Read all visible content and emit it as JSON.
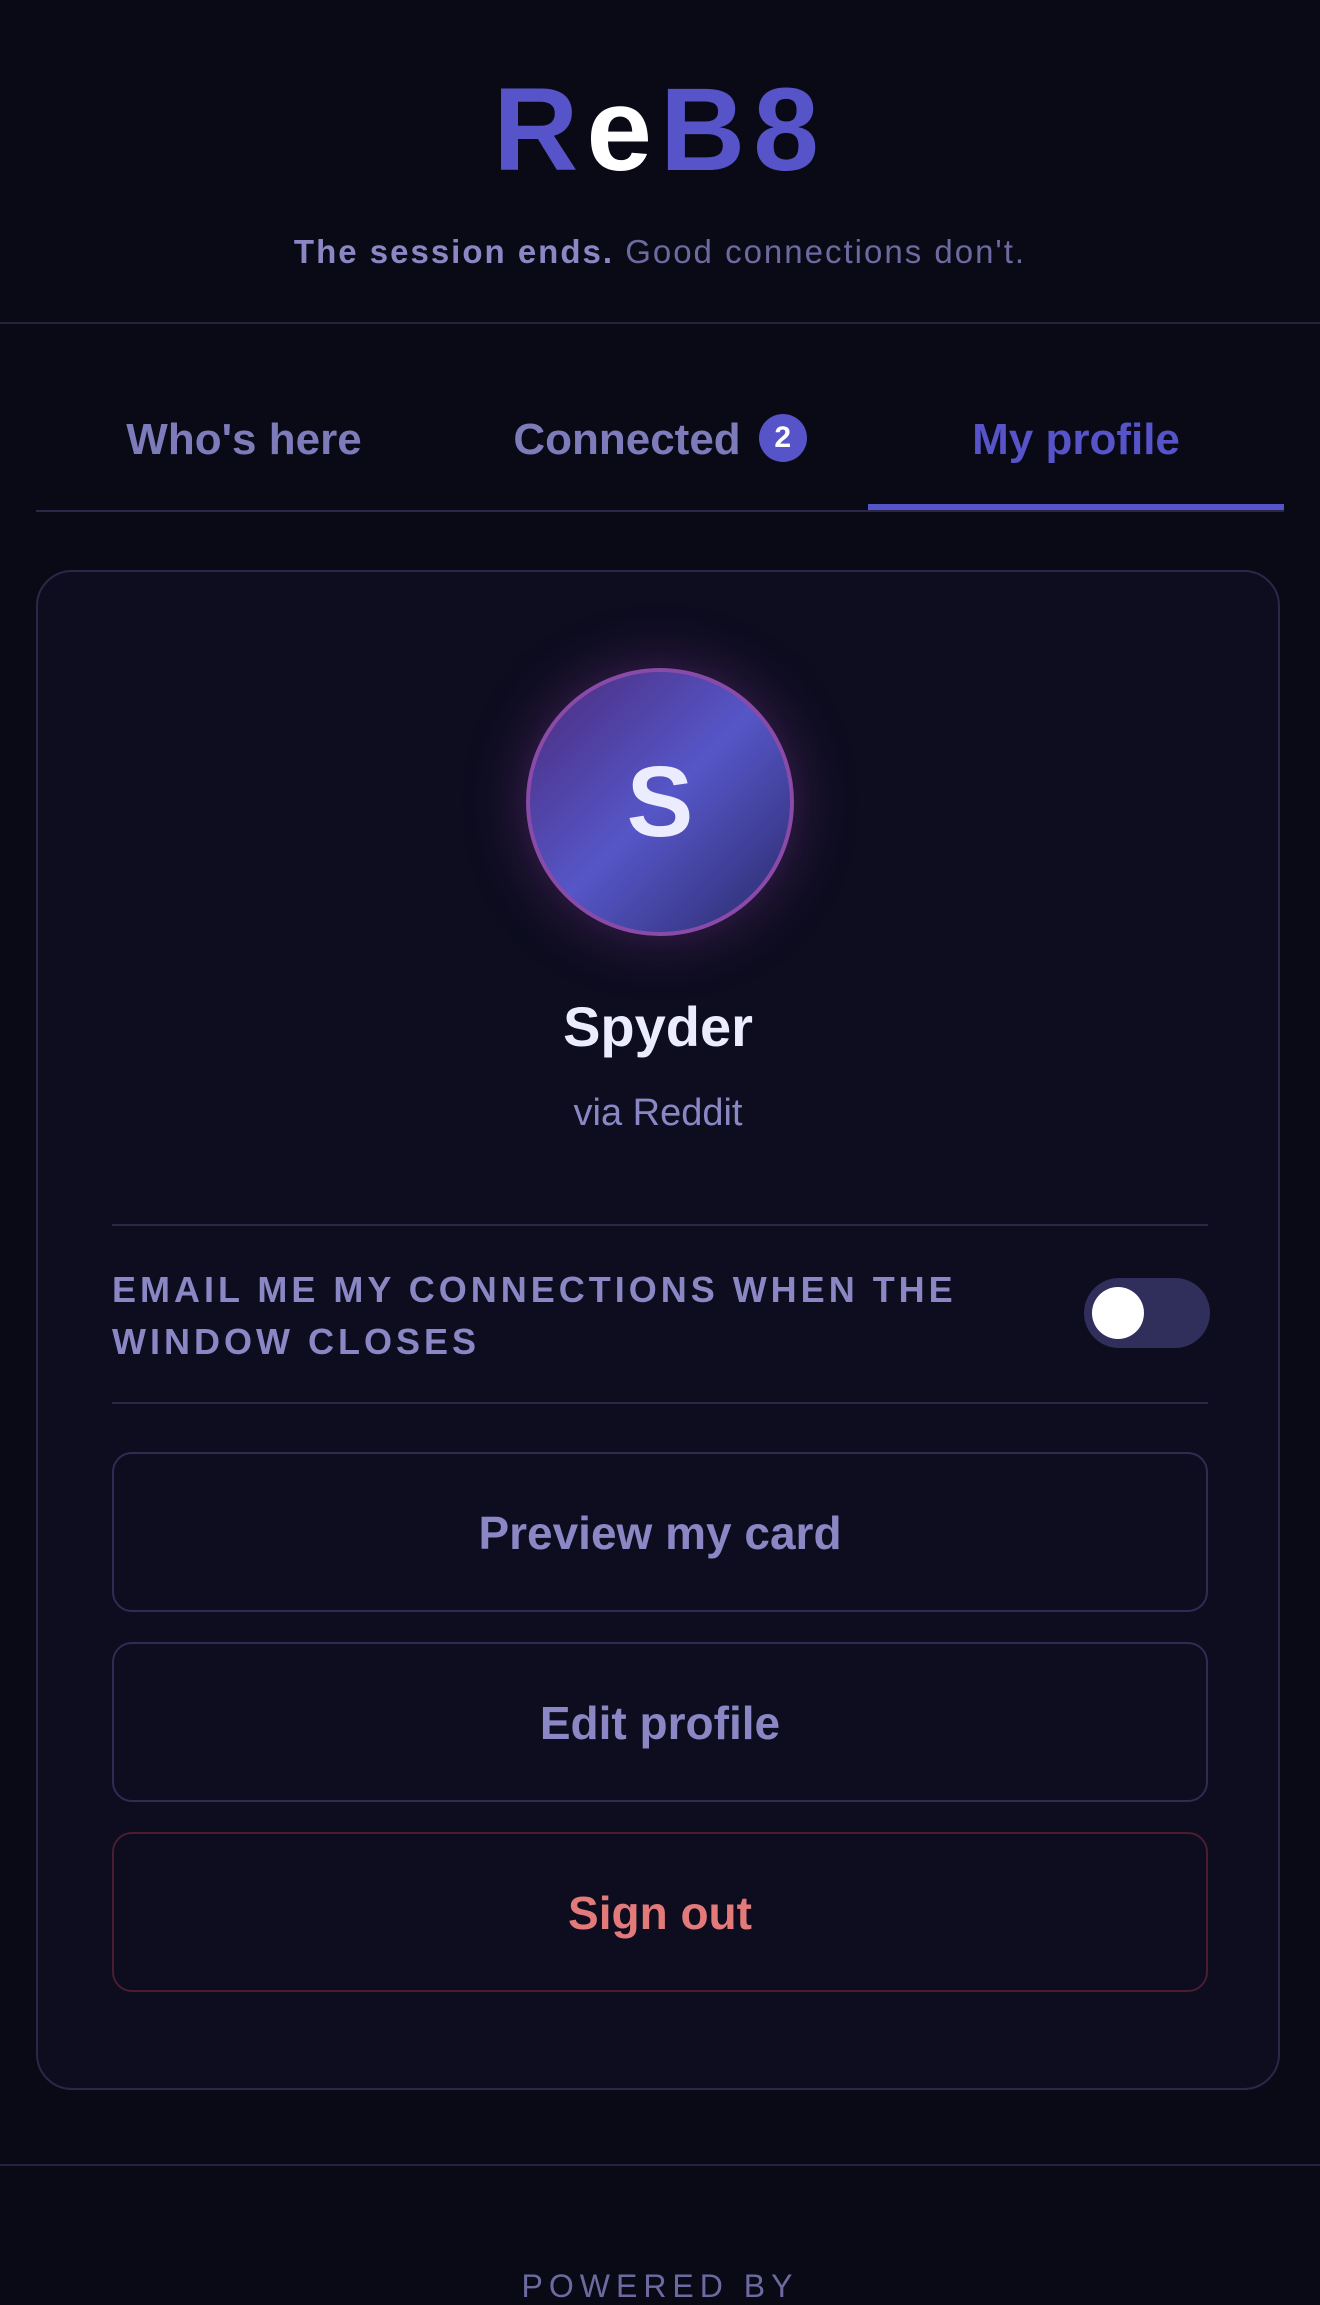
{
  "header": {
    "logo": {
      "part1": "R",
      "part2": "e",
      "part3": "B8"
    },
    "tagline_strong": "The session ends.",
    "tagline_rest": "Good connections don't."
  },
  "tabs": [
    {
      "label": "Who's here",
      "active": false
    },
    {
      "label": "Connected",
      "badge": "2",
      "active": false
    },
    {
      "label": "My profile",
      "active": true
    }
  ],
  "profile": {
    "avatar_initial": "S",
    "name": "Spyder",
    "source": "via Reddit",
    "email_toggle_label_line1": "EMAIL ME MY CONNECTIONS WHEN THE",
    "email_toggle_label_line2": "WINDOW CLOSES",
    "email_toggle_on": false
  },
  "actions": {
    "preview_label": "Preview my card",
    "edit_label": "Edit profile",
    "signout_label": "Sign out"
  },
  "footer": {
    "powered_by": "POWERED BY"
  },
  "colors": {
    "accent": "#5654c8",
    "background": "#0a0a17",
    "danger": "#e37a7a",
    "muted_text": "#8a87c4"
  }
}
